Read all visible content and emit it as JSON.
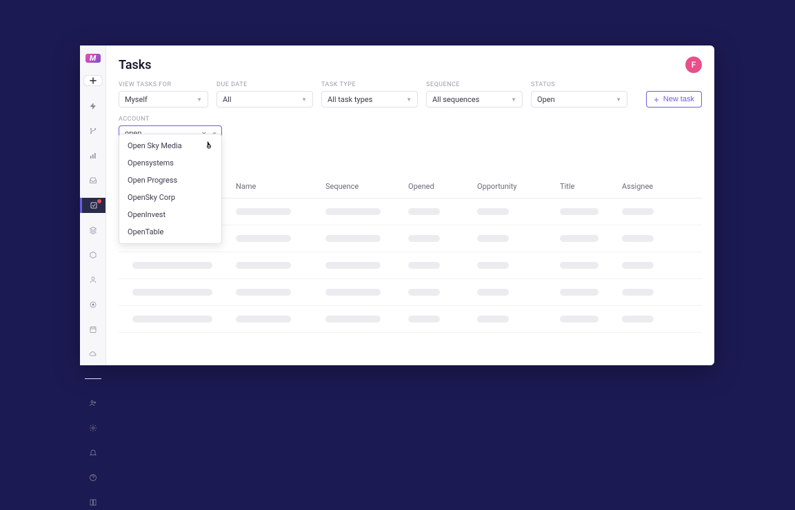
{
  "header": {
    "title": "Tasks",
    "avatar_initial": "F"
  },
  "filters": {
    "view_tasks_for": {
      "label": "VIEW TASKS FOR",
      "value": "Myself"
    },
    "due_date": {
      "label": "DUE DATE",
      "value": "All"
    },
    "task_type": {
      "label": "TASK TYPE",
      "value": "All task types"
    },
    "sequence": {
      "label": "SEQUENCE",
      "value": "All sequences"
    },
    "status": {
      "label": "STATUS",
      "value": "Open"
    },
    "account": {
      "label": "ACCOUNT",
      "value": "open"
    }
  },
  "account_options": [
    "Open Sky Media",
    "Opensystems",
    "Open Progress",
    "OpenSky Corp",
    "OpenInvest",
    "OpenTable"
  ],
  "new_task_label": "New task",
  "columns": {
    "name": "Name",
    "sequence": "Sequence",
    "opened": "Opened",
    "opportunity": "Opportunity",
    "title": "Title",
    "assignee": "Assignee"
  }
}
